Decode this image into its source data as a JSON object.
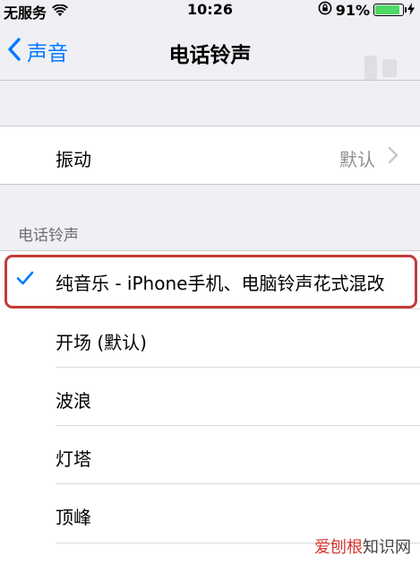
{
  "status_bar": {
    "carrier": "无服务",
    "time": "10:26",
    "battery_percent": "91%",
    "battery_level": 0.91,
    "battery_color": "#4cd964"
  },
  "nav": {
    "back_label": "声音",
    "title": "电话铃声",
    "accent_color": "#007aff"
  },
  "vibration_row": {
    "label": "振动",
    "value": "默认"
  },
  "ringtone_section": {
    "header": "电话铃声",
    "selected_color": "#007aff",
    "items": [
      {
        "label": "纯音乐 - iPhone手机、电脑铃声花式混改",
        "selected": true
      },
      {
        "label": "开场 (默认)",
        "selected": false
      },
      {
        "label": "波浪",
        "selected": false
      },
      {
        "label": "灯塔",
        "selected": false
      },
      {
        "label": "顶峰",
        "selected": false
      }
    ]
  },
  "watermark": {
    "part1": "爱刨根",
    "part2": "知识网"
  }
}
